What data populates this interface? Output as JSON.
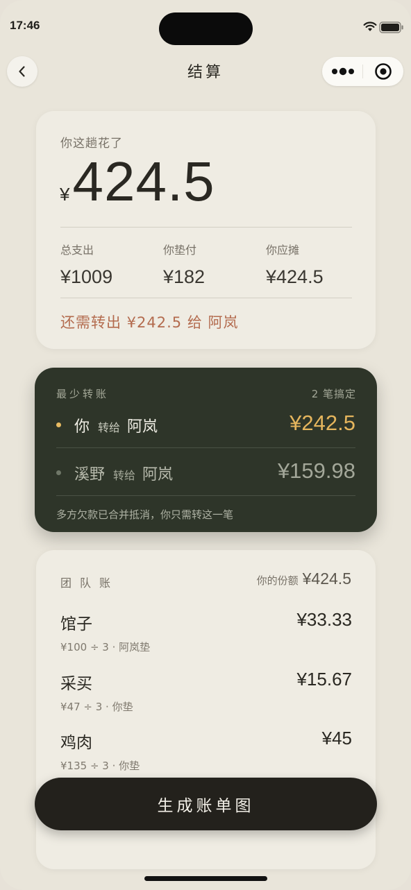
{
  "status_bar": {
    "time": "17:46"
  },
  "header": {
    "title": "结算"
  },
  "summary": {
    "spent_label": "你这趟花了",
    "currency": "¥",
    "amount": "424.5",
    "stats": [
      {
        "label": "总支出",
        "value": "¥1009"
      },
      {
        "label": "你垫付",
        "value": "¥182"
      },
      {
        "label": "你应摊",
        "value": "¥424.5"
      }
    ],
    "owe_note": "还需转出 ¥242.5 给 阿岚"
  },
  "transfers": {
    "title": "最少转账",
    "count": "2 笔搞定",
    "rows": [
      {
        "from": "你",
        "to_word": "转给",
        "to": "阿岚",
        "amount": "¥242.5"
      },
      {
        "from": "溪野",
        "to_word": "转给",
        "to": "阿岚",
        "amount": "¥159.98"
      }
    ],
    "note": "多方欠款已合并抵消，你只需转这一笔"
  },
  "team": {
    "title": "团队账",
    "share_label": "你的份额",
    "share_value": "¥424.5",
    "items": [
      {
        "name": "馆子",
        "detail": "¥100 ÷ 3 · 阿岚垫",
        "price": "¥33.33"
      },
      {
        "name": "采买",
        "detail": "¥47 ÷ 3 · 你垫",
        "price": "¥15.67"
      },
      {
        "name": "鸡肉",
        "detail": "¥135 ÷ 3 · 你垫",
        "price": "¥45"
      }
    ]
  },
  "footer": {
    "button_label": "生成账单图"
  }
}
